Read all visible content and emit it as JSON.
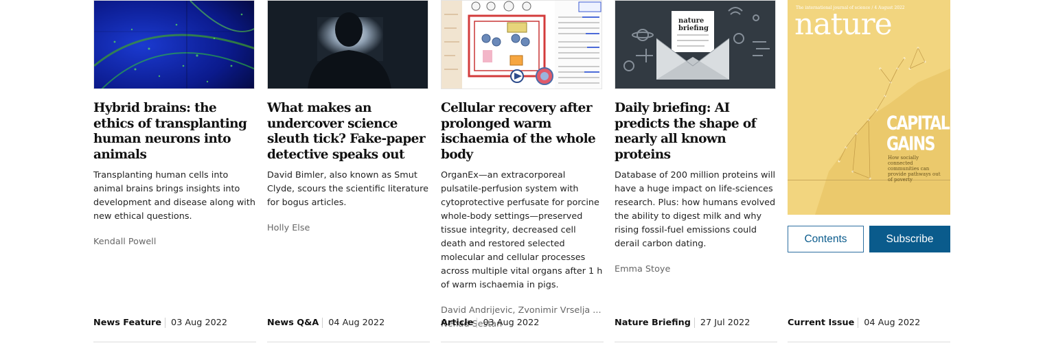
{
  "cards": [
    {
      "headline": "Hybrid brains: the ethics of transplanting human neurons into animals",
      "summary": "Transplanting human cells into animal brains brings insights into development and disease along with new ethical questions.",
      "authors": "Kendall Powell",
      "type": "News Feature",
      "date": "03 Aug 2022",
      "image": "brain-tissue-microscopy"
    },
    {
      "headline": "What makes an undercover science sleuth tick? Fake-paper detective speaks out",
      "summary": "David Bimler, also known as Smut Clyde, scours the scientific literature for bogus articles.",
      "authors": "Holly Else",
      "type": "News Q&A",
      "date": "04 Aug 2022",
      "image": "silhouette-at-computer"
    },
    {
      "headline": "Cellular recovery after prolonged warm ischaemia of the whole body",
      "summary": "OrganEx—an extracorporeal pulsatile-perfusion system with cytoprotective perfusate for porcine whole-body settings—preserved tissue integrity, decreased cell death and restored selected molecular and cellular processes across multiple vital organs after 1 h of warm ischaemia in pigs.",
      "authors_line1": "David Andrijevic, Zvonimir Vrselja ...",
      "authors_line2": "Nenad Sestan",
      "type": "Article",
      "date": "03 Aug 2022",
      "image": "organex-schematic"
    },
    {
      "headline": "Daily briefing: AI predicts the shape of nearly all known proteins",
      "summary": "Database of 200 million proteins will have a huge impact on life-sciences research. Plus: how humans evolved the ability to digest milk and why rising fossil-fuel emissions could derail carbon dating.",
      "authors": "Emma Stoye",
      "type": "Nature Briefing",
      "date": "27 Jul 2022",
      "image": "nature-briefing-envelope",
      "image_text": "nature briefing"
    }
  ],
  "current_issue": {
    "cover_masthead": "nature",
    "cover_header": "The international journal of science / 4 August 2022",
    "cover_headline_1": "CAPITAL",
    "cover_headline_2": "GAINS",
    "cover_subhead": "How socially connected communities can provide pathways out of poverty",
    "contents_label": "Contents",
    "subscribe_label": "Subscribe",
    "type": "Current Issue",
    "date": "04 Aug 2022"
  }
}
